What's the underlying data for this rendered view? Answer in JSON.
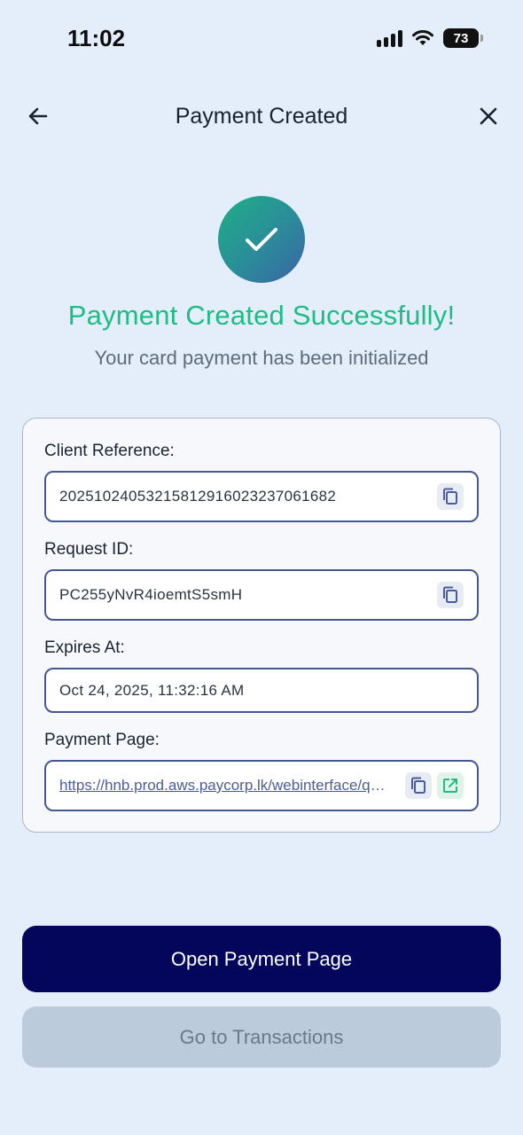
{
  "status_bar": {
    "time": "11:02",
    "battery": "73"
  },
  "header": {
    "title": "Payment Created",
    "back_icon": "arrow-left-icon",
    "close_icon": "close-icon"
  },
  "success": {
    "icon": "check-icon",
    "title": "Payment Created Successfully!",
    "subtitle": "Your card payment has been initialized"
  },
  "details": {
    "client_reference": {
      "label": "Client Reference:",
      "value": "20251024053215812916023237061682"
    },
    "request_id": {
      "label": "Request ID:",
      "value": "PC255yNvR4ioemtS5smH"
    },
    "expires_at": {
      "label": "Expires At:",
      "value": "Oct 24, 2025, 11:32:16 AM"
    },
    "payment_page": {
      "label": "Payment Page:",
      "value": "https://hnb.prod.aws.paycorp.lk/webinterface/qw/paycorp"
    }
  },
  "actions": {
    "open_payment_page": "Open Payment Page",
    "go_to_transactions": "Go to Transactions"
  },
  "colors": {
    "background": "#e3eefa",
    "success_green": "#1fbc84",
    "primary_button": "#03065a",
    "field_border": "#45578f"
  }
}
